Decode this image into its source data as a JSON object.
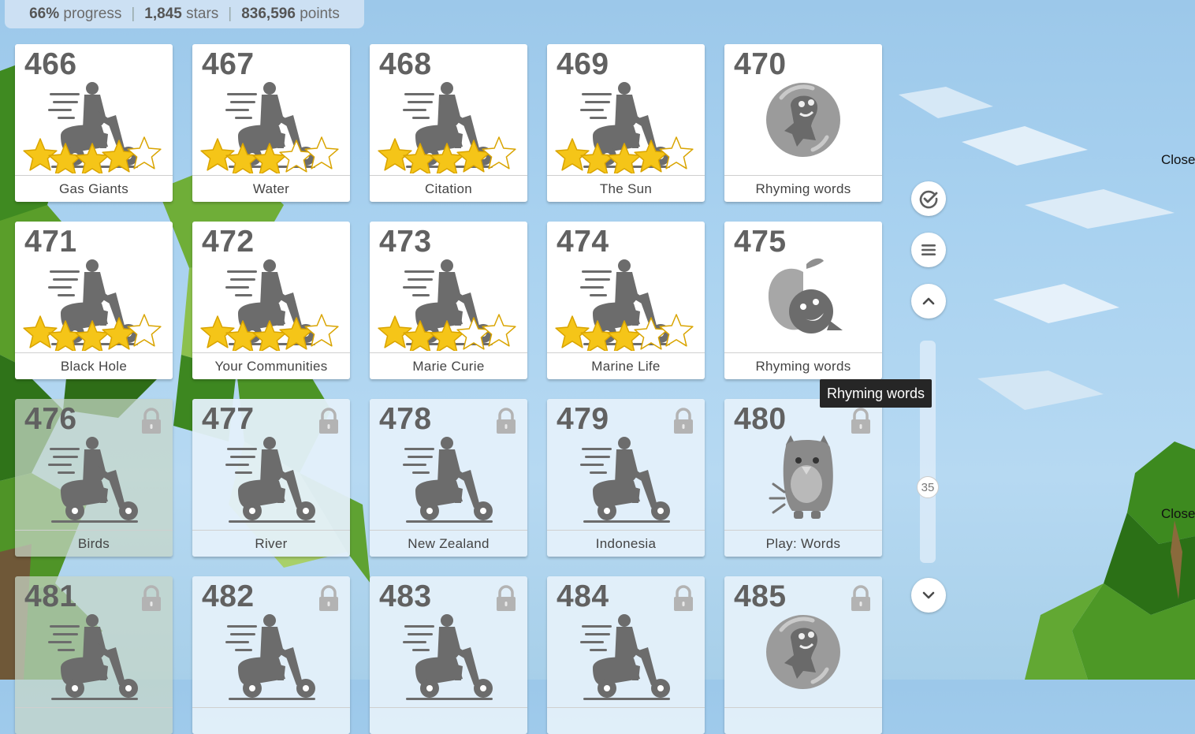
{
  "stats": {
    "progress_value": "66%",
    "progress_word": "progress",
    "stars_value": "1,845",
    "stars_word": "stars",
    "points_value": "836,596",
    "points_word": "points"
  },
  "levels": [
    {
      "number": "466",
      "label": "Gas Giants",
      "stars_earned": 4,
      "state": "done",
      "art": "scooter"
    },
    {
      "number": "467",
      "label": "Water",
      "stars_earned": 3,
      "state": "done",
      "art": "scooter"
    },
    {
      "number": "468",
      "label": "Citation",
      "stars_earned": 4,
      "state": "done",
      "art": "scooter"
    },
    {
      "number": "469",
      "label": "The Sun",
      "stars_earned": 4,
      "state": "done",
      "art": "scooter"
    },
    {
      "number": "470",
      "label": "Rhyming words",
      "stars_earned": 0,
      "state": "done",
      "art": "bubble"
    },
    {
      "number": "471",
      "label": "Black Hole",
      "stars_earned": 4,
      "state": "done",
      "art": "scooter"
    },
    {
      "number": "472",
      "label": "Your Communities",
      "stars_earned": 4,
      "state": "done",
      "art": "scooter"
    },
    {
      "number": "473",
      "label": "Marie Curie",
      "stars_earned": 3,
      "state": "done",
      "art": "scooter"
    },
    {
      "number": "474",
      "label": "Marine Life",
      "stars_earned": 3,
      "state": "done",
      "art": "scooter"
    },
    {
      "number": "475",
      "label": "Rhyming words",
      "stars_earned": 0,
      "state": "done",
      "art": "apple"
    },
    {
      "number": "476",
      "label": "Birds",
      "stars_earned": 0,
      "state": "dim",
      "art": "scooter"
    },
    {
      "number": "477",
      "label": "River",
      "stars_earned": 0,
      "state": "locked",
      "art": "scooter"
    },
    {
      "number": "478",
      "label": "New Zealand",
      "stars_earned": 0,
      "state": "locked",
      "art": "scooter"
    },
    {
      "number": "479",
      "label": "Indonesia",
      "stars_earned": 0,
      "state": "locked",
      "art": "scooter"
    },
    {
      "number": "480",
      "label": "Play: Words",
      "stars_earned": 0,
      "state": "locked",
      "art": "monster"
    },
    {
      "number": "481",
      "label": "",
      "stars_earned": 0,
      "state": "dim",
      "art": "scooter"
    },
    {
      "number": "482",
      "label": "",
      "stars_earned": 0,
      "state": "locked",
      "art": "scooter"
    },
    {
      "number": "483",
      "label": "",
      "stars_earned": 0,
      "state": "locked",
      "art": "scooter"
    },
    {
      "number": "484",
      "label": "",
      "stars_earned": 0,
      "state": "locked",
      "art": "scooter"
    },
    {
      "number": "485",
      "label": "",
      "stars_earned": 0,
      "state": "locked",
      "art": "bubble"
    }
  ],
  "sidebar": {
    "buttons": [
      {
        "name": "complete-check-button",
        "icon": "check-circle-icon"
      },
      {
        "name": "menu-button",
        "icon": "hamburger-menu-icon"
      },
      {
        "name": "scroll-up-button",
        "icon": "chevron-up-icon"
      },
      {
        "name": "scroll-down-button",
        "icon": "chevron-down-icon"
      }
    ],
    "scroll_label": "35"
  },
  "tooltip": {
    "text": "Rhyming words"
  },
  "close_links": [
    "Close",
    "Close"
  ],
  "colors": {
    "star_gold": "#f5c518",
    "star_outline": "#d9a400",
    "tooltip_bg": "#262626",
    "icon_gray": "#6c6c6c"
  }
}
